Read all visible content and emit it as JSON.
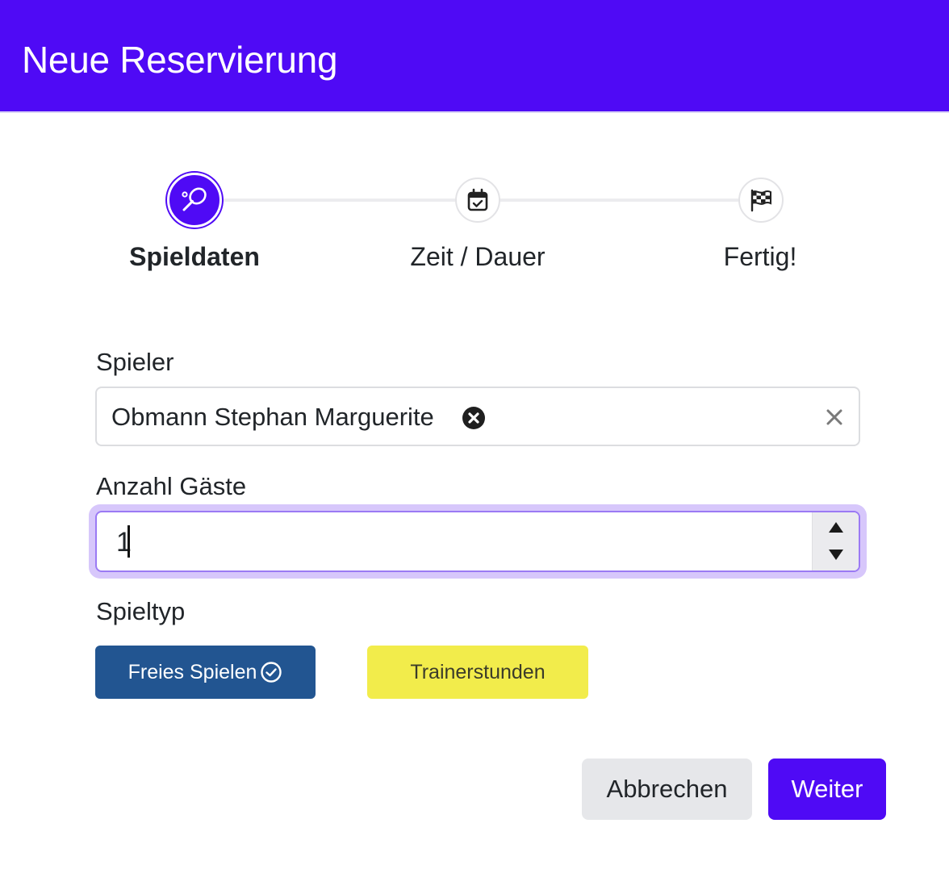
{
  "header": {
    "title": "Neue Reservierung"
  },
  "stepper": {
    "steps": [
      {
        "label": "Spieldaten",
        "icon": "tennis-racket-icon",
        "state": "active"
      },
      {
        "label": "Zeit / Dauer",
        "icon": "calendar-check-icon",
        "state": "inactive"
      },
      {
        "label": "Fertig!",
        "icon": "finish-flag-icon",
        "state": "inactive"
      }
    ]
  },
  "form": {
    "player": {
      "label": "Spieler",
      "selected": "Obmann Stephan Marguerite"
    },
    "guests": {
      "label": "Anzahl Gäste",
      "value": "1"
    },
    "game_type": {
      "label": "Spieltyp",
      "options": [
        {
          "label": "Freies Spielen",
          "selected": true
        },
        {
          "label": "Trainerstunden",
          "selected": false
        }
      ]
    }
  },
  "actions": {
    "cancel_label": "Abbrechen",
    "next_label": "Weiter"
  },
  "colors": {
    "primary": "#4f0af5",
    "selected_type": "#225591",
    "trainer_type": "#f2ec4b",
    "cancel_bg": "#e6e7ea"
  }
}
